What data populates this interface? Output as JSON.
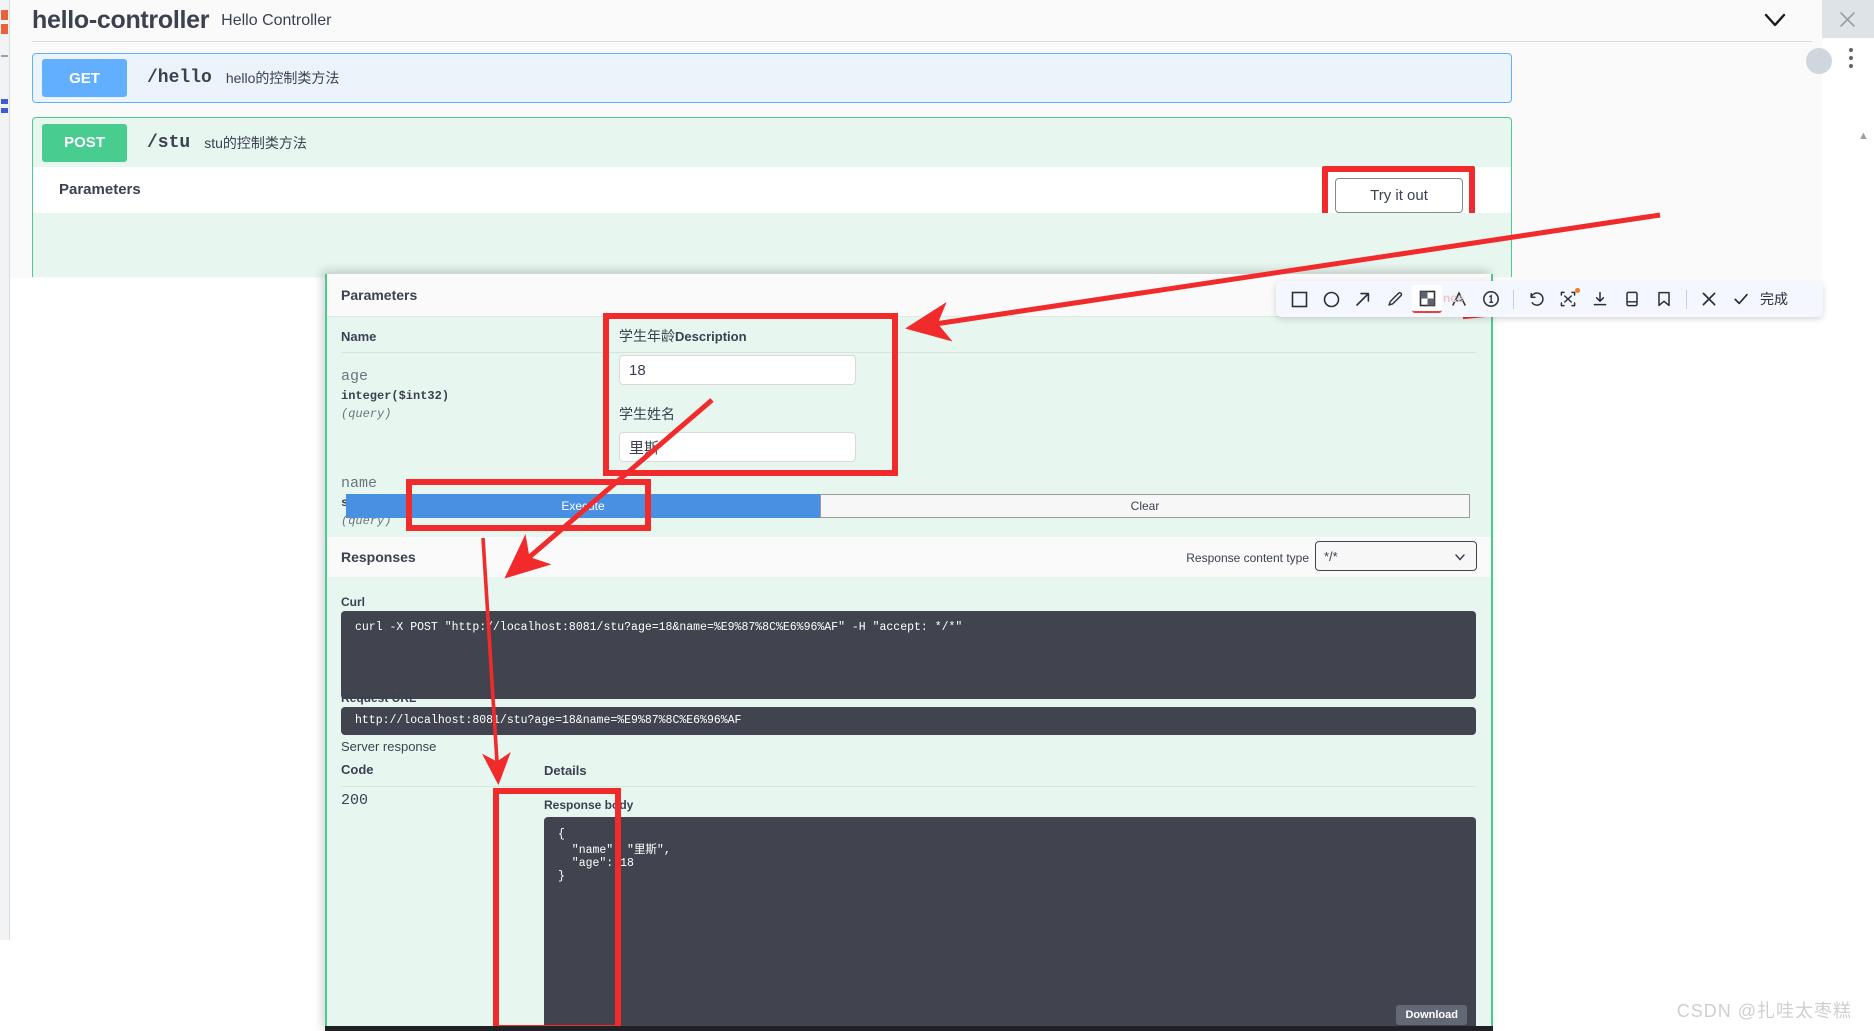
{
  "browser": {
    "close_icon": "close-icon",
    "menu_icon": "kebab-menu-icon",
    "collapse_icon": "chevron-down-icon"
  },
  "swagger": {
    "controller_title": "hello-controller",
    "controller_subtitle": "Hello Controller",
    "operations": [
      {
        "verb": "GET",
        "path": "/hello",
        "summary": "hello的控制类方法"
      },
      {
        "verb": "POST",
        "path": "/stu",
        "summary": "stu的控制类方法"
      }
    ],
    "parameters_heading": "Parameters",
    "try_it_out_label": "Try it out"
  },
  "panel": {
    "params_heading": "Parameters",
    "columns": {
      "name": "Name",
      "description": "Description"
    },
    "parameters": [
      {
        "name": "age",
        "type": "integer($int32)",
        "in": "(query)",
        "label": "学生年龄",
        "value": "18"
      },
      {
        "name": "name",
        "type": "string",
        "in": "(query)",
        "label": "学生姓名",
        "value": "里斯"
      }
    ],
    "execute_label": "Execute",
    "clear_label": "Clear",
    "responses_heading": "Responses",
    "response_content_type_label": "Response content type",
    "response_content_type_value": "*/*",
    "curl_label": "Curl",
    "curl_value": "curl -X POST \"http://localhost:8081/stu?age=18&name=%E9%87%8C%E6%96%AF\" -H \"accept: */*\"",
    "request_url_label": "Request URL",
    "request_url_value": "http://localhost:8081/stu?age=18&name=%E9%87%8C%E6%96%AF",
    "server_response_label": "Server response",
    "code_column": "Code",
    "details_column": "Details",
    "status_code": "200",
    "response_body_label": "Response body",
    "response_body_value": "{\n  \"name\": \"里斯\",\n  \"age\": 18\n}",
    "download_label": "Download"
  },
  "annotation_toolbar": {
    "tools": [
      {
        "name": "rectangle-icon",
        "active": false
      },
      {
        "name": "ellipse-icon",
        "active": false
      },
      {
        "name": "arrow-icon",
        "active": false
      },
      {
        "name": "pen-icon",
        "active": false
      },
      {
        "name": "mosaic-icon",
        "active": true
      },
      {
        "name": "text-icon",
        "active": false
      },
      {
        "name": "number-icon",
        "active": false
      },
      {
        "name": "undo-icon",
        "active": false
      },
      {
        "name": "ocr-icon",
        "active": false
      },
      {
        "name": "download-icon",
        "active": false
      },
      {
        "name": "pin-icon",
        "active": false
      },
      {
        "name": "bookmark-icon",
        "active": false
      },
      {
        "name": "close-icon",
        "active": false
      }
    ],
    "done_label": "完成",
    "ghost_tooltip_text": "nce"
  },
  "colors": {
    "get": "#61affe",
    "post": "#49cc90",
    "execute": "#4990e2",
    "annotation_red": "#f12b2b",
    "code_bg": "#41444e"
  },
  "watermark": "CSDN @扎哇太枣糕"
}
